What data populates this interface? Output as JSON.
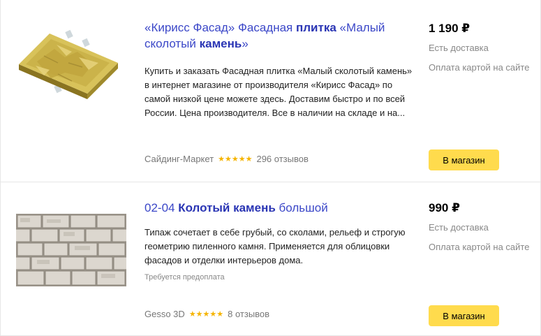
{
  "results": [
    {
      "title_parts": [
        "«Кирисс Фасад» Фасадная ",
        "плитка",
        " «Малый ",
        "сколотый ",
        "камень",
        "»"
      ],
      "description": "Купить и заказать Фасадная плитка «Малый сколотый камень» в интернет магазине от производителя «Кирисс Фасад» по самой низкой цене можете здесь. Доставим быстро и по всей России. Цена производителя. Все в наличии на складе и на...",
      "shop": "Сайдинг-Маркет",
      "stars": "★★★★★",
      "reviews": "296 отзывов",
      "price": "1 190 ₽",
      "delivery": "Есть доставка",
      "payment": "Оплата картой на сайте",
      "button": "В магазин"
    },
    {
      "title_parts": [
        "02-04 ",
        "Колотый камень",
        " большой"
      ],
      "description": "Типаж сочетает в себе грубый, со сколами, рельеф и строгую геометрию пиленного камня. Применяется для облицовки фасадов и отделки интерьеров дома.",
      "note": "Требуется предоплата",
      "shop": "Gesso 3D",
      "stars": "★★★★★",
      "reviews": "8 отзывов",
      "price": "990 ₽",
      "delivery": "Есть доставка",
      "payment": "Оплата картой на сайте",
      "button": "В магазин"
    }
  ]
}
